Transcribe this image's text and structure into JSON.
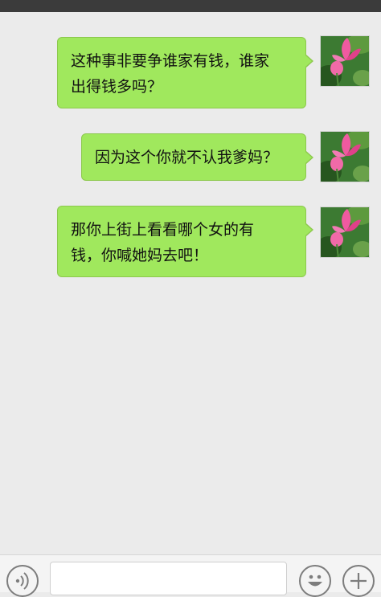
{
  "chat": {
    "messages": [
      {
        "sender": "self",
        "text_line1": "这种事非要争谁家有钱，谁家",
        "text_line2": "出得钱多吗？"
      },
      {
        "sender": "self",
        "text_line1": "因为这个你就不认我爹妈？",
        "text_line2": ""
      },
      {
        "sender": "self",
        "text_line1": "那你上街上看看哪个女的有",
        "text_line2": "钱，你喊她妈去吧！"
      }
    ]
  },
  "input_bar": {
    "voice_icon": "voice-icon",
    "emoji_icon": "emoji-icon",
    "plus_icon": "plus-icon",
    "text_value": ""
  },
  "colors": {
    "bubble": "#a0e85d",
    "background": "#ebebeb",
    "topbar": "#3b3b3b"
  }
}
